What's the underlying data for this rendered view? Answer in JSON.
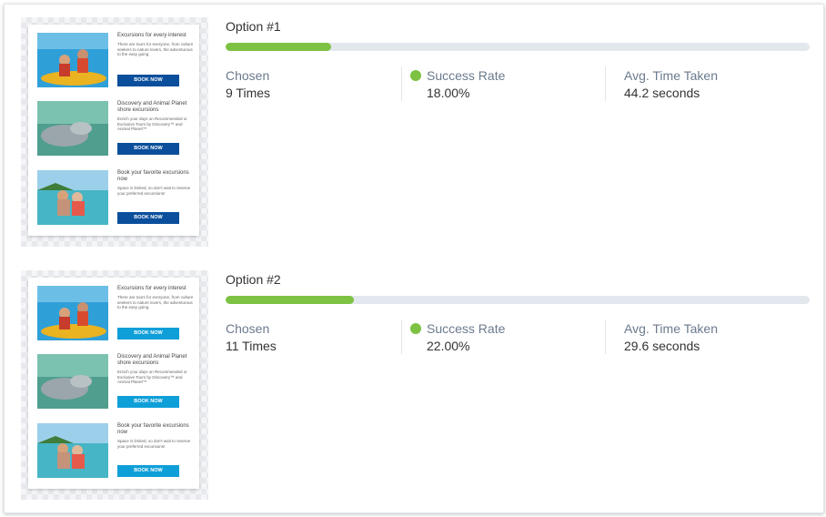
{
  "accent_green": "#7dc243",
  "options": [
    {
      "title": "Option #1",
      "progress": 0.18,
      "chosen_label": "Chosen",
      "chosen_value": "9 Times",
      "success_label": "Success Rate",
      "success_value": "18.00%",
      "time_label": "Avg. Time Taken",
      "time_value": "44.2 seconds",
      "button_color": "#0b4f9c",
      "email": [
        {
          "title": "Excursions for every interest",
          "body": "There are tours for everyone, from culture seekers to nature lovers, the adventurous to the easy going.",
          "button": "BOOK NOW"
        },
        {
          "title": "Discovery and Animal Planet shore excursions",
          "body": "Enrich your days on Recommended or Exclusive Tours by Discovery™ and Animal Planet™",
          "button": "BOOK NOW"
        },
        {
          "title": "Book your favorite excursions now",
          "body": "Space is limited, so don't wait to reserve your preferred excursions!",
          "button": "BOOK NOW"
        }
      ]
    },
    {
      "title": "Option #2",
      "progress": 0.22,
      "chosen_label": "Chosen",
      "chosen_value": "11 Times",
      "success_label": "Success Rate",
      "success_value": "22.00%",
      "time_label": "Avg. Time Taken",
      "time_value": "29.6 seconds",
      "button_color": "#0f9fd8",
      "email": [
        {
          "title": "Excursions for every interest",
          "body": "There are tours for everyone, from culture seekers to nature lovers, the adventurous to the easy going.",
          "button": "BOOK NOW"
        },
        {
          "title": "Discovery and Animal Planet shore excursions",
          "body": "Enrich your days on Recommended or Exclusive Tours by Discovery™ and Animal Planet™",
          "button": "BOOK NOW"
        },
        {
          "title": "Book your favorite excursions now",
          "body": "Space is limited, so don't wait to reserve your preferred excursions!",
          "button": "BOOK NOW"
        }
      ]
    }
  ]
}
